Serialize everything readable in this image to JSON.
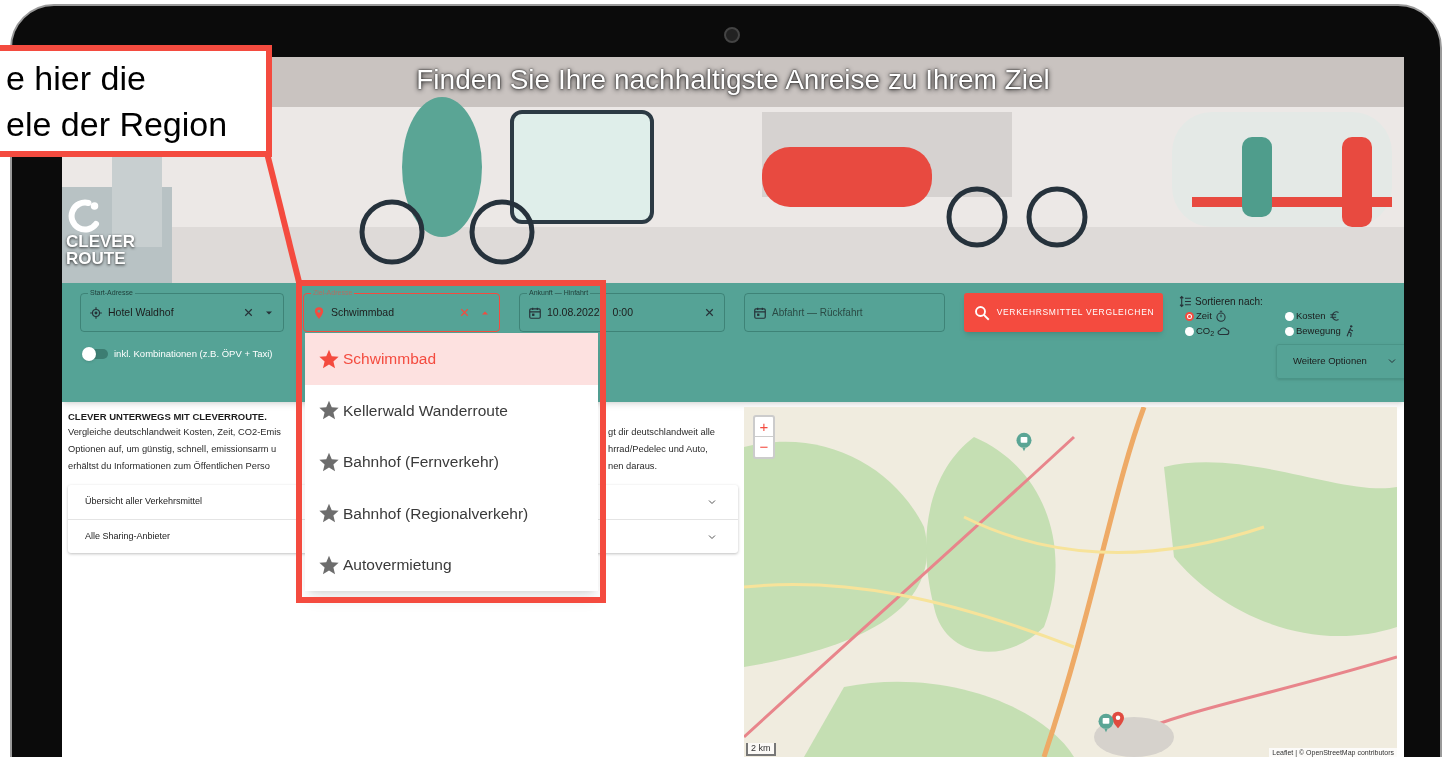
{
  "callout": {
    "lines": [
      "e hier die",
      "ele der Region"
    ]
  },
  "banner": {
    "title": "Finden Sie Ihre nachhaltigste Anreise zu Ihrem Ziel",
    "logo": [
      "CLEVER",
      "ROUTE"
    ]
  },
  "search": {
    "fields": [
      {
        "kind": "start",
        "label": "Start-Adresse",
        "value": "Hotel Waldhof",
        "clearable": true,
        "focused": false
      },
      {
        "kind": "destination",
        "label": "Ziel-Adresse",
        "value": "Schwimmbad",
        "clearable": true,
        "focused": true
      },
      {
        "kind": "date",
        "label": "Ankunft — Hinfahrt",
        "value": "10.08.2022",
        "value_rest": "0:00",
        "clearable": true,
        "focused": false
      },
      {
        "kind": "date",
        "placeholder": "Abfahrt — Rückfahrt",
        "clearable": false,
        "focused": false
      }
    ],
    "toggle": {
      "label": "inkl. Kombinationen (z.B. ÖPV + Taxi)",
      "on": false
    },
    "button": "VERKEHRSMITTEL VERGLEICHEN",
    "sort": {
      "label": "Sortieren nach:",
      "options": [
        {
          "label": "Zeit",
          "kind": "time",
          "selected": true
        },
        {
          "label": "Kosten",
          "kind": "cost",
          "selected": false
        },
        {
          "label": "CO$_{2}$",
          "kind": "co2",
          "selected": false
        },
        {
          "label": "Bewegung",
          "kind": "exercise",
          "selected": false
        }
      ]
    },
    "more_options": "Weitere Optionen"
  },
  "suggestions": [
    {
      "label": "Schwimmbad",
      "selected": true
    },
    {
      "label": "Kellerwald Wanderroute",
      "selected": false
    },
    {
      "label": "Bahnhof (Fernverkehr)",
      "selected": false
    },
    {
      "label": "Bahnhof (Regionalverkehr)",
      "selected": false
    },
    {
      "label": "Autovermietung",
      "selected": false
    }
  ],
  "intro": {
    "title": "CLEVER UNTERWEGS MIT CLEVERROUTE.",
    "lines": [
      {
        "left": "Vergleiche deutschlandweit Kosten, Zeit, CO2-Emis",
        "right": "gt dir deutschlandweit alle"
      },
      {
        "left": "Optionen auf, um günstig, schnell, emissionsarm u",
        "right": "hrrad/Pedelec und Auto,"
      },
      {
        "left": "erhältst du Informationen zum Öffentlichen Perso",
        "right": "nen daraus."
      }
    ]
  },
  "accordion": [
    "Übersicht aller Verkehrsmittel",
    "Alle Sharing-Anbieter"
  ],
  "map": {
    "zoom_in": "+",
    "zoom_out": "−",
    "scale": "2 km",
    "attribution": "Leaflet | © OpenStreetMap contributors"
  }
}
